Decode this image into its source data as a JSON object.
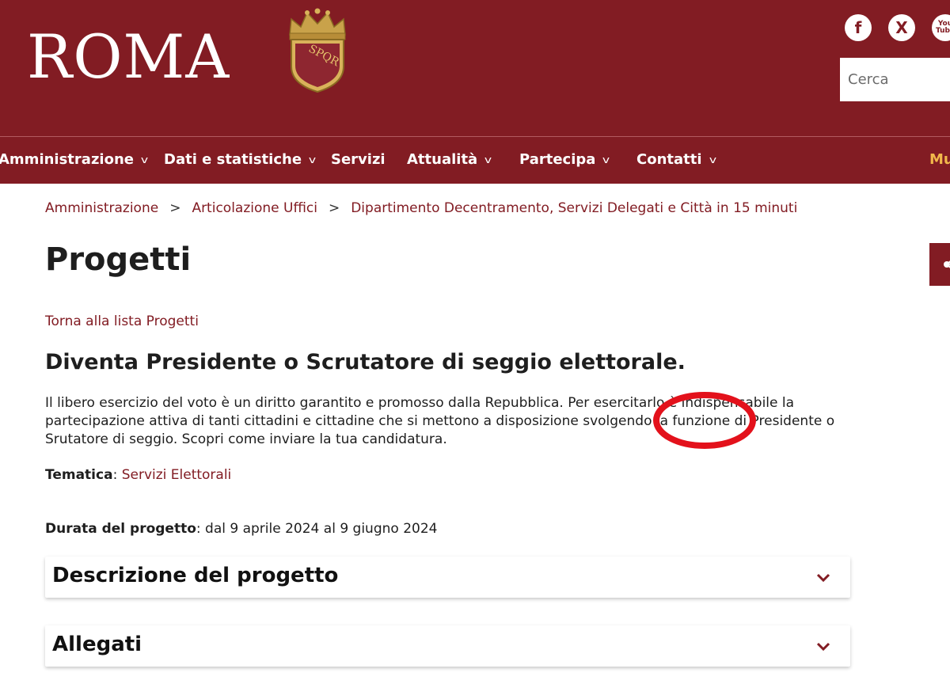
{
  "header": {
    "logo": "ROMA",
    "crest_text": "SPQR",
    "social": [
      {
        "name": "facebook",
        "glyph": "f"
      },
      {
        "name": "x",
        "glyph": "X"
      },
      {
        "name": "youtube",
        "glyph": "You Tube"
      }
    ],
    "search_placeholder": "Cerca"
  },
  "nav": {
    "items": [
      {
        "label": "Amministrazione",
        "dropdown": true
      },
      {
        "label": "Dati e statistiche",
        "dropdown": true
      },
      {
        "label": "Servizi",
        "dropdown": false
      },
      {
        "label": "Attualità",
        "dropdown": true
      },
      {
        "label": "Partecipa",
        "dropdown": true
      },
      {
        "label": "Contatti",
        "dropdown": true
      },
      {
        "label": "Mu",
        "dropdown": false
      }
    ],
    "chevron": "v"
  },
  "breadcrumb": {
    "items": [
      "Amministrazione",
      "Articolazione Uffici",
      "Dipartimento Decentramento, Servizi Delegati e Città in 15 minuti"
    ],
    "separator": ">"
  },
  "page": {
    "title": "Progetti",
    "back_link": "Torna alla lista Progetti",
    "project_title": "Diventa Presidente o Scrutatore di seggio elettorale.",
    "description": "Il libero esercizio del voto è un diritto garantito e promosso dalla Repubblica. Per esercitarlo è indispensabile la partecipazione attiva di tanti cittadini e cittadine che si mettono a disposizione svolgendo la funzione di Presidente o Srutatore di seggio. Scopri come inviare la tua candidatura.",
    "tematica_label": "Tematica",
    "tematica_value": "Servizi Elettorali",
    "durata_label": "Durata del progetto",
    "durata_value": "dal 9 aprile 2024 al 9 giugno 2024"
  },
  "accordions": [
    {
      "title": "Descrizione del progetto"
    },
    {
      "title": "Allegati"
    }
  ],
  "colors": {
    "brand": "#821c23",
    "accent_gold": "#f2b84b",
    "annotation_red": "#e3111b"
  }
}
